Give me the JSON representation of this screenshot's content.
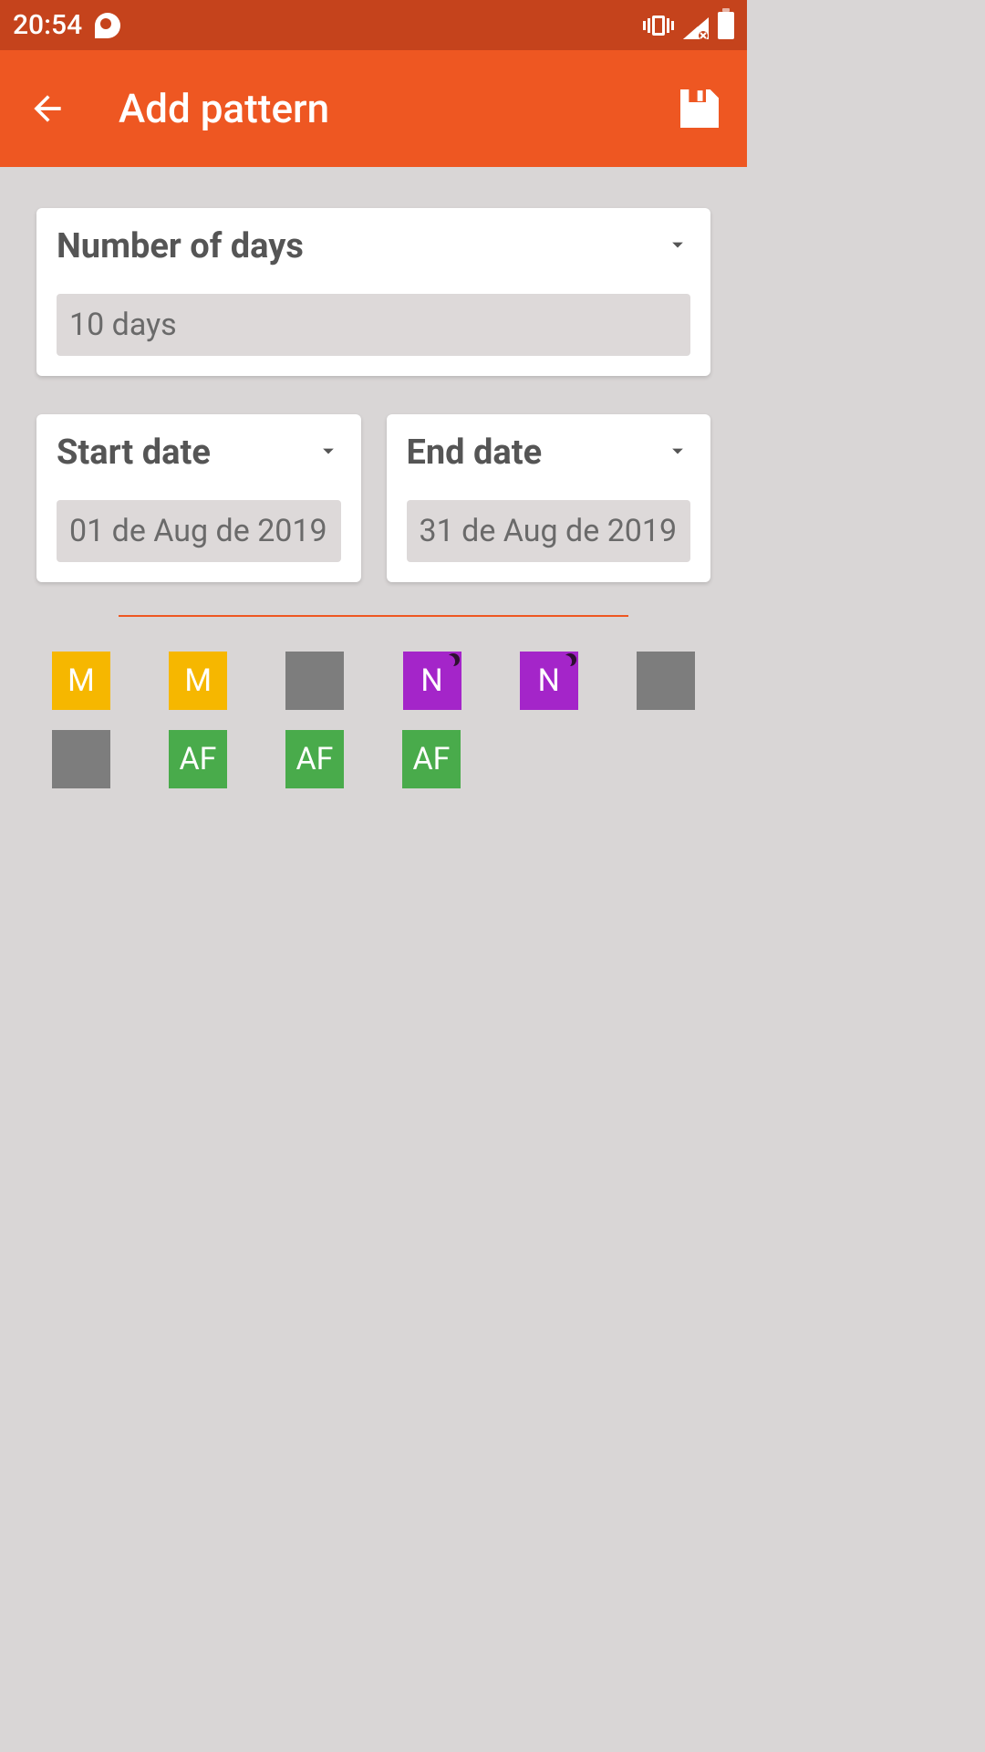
{
  "status_bar": {
    "time": "20:54"
  },
  "app_bar": {
    "title": "Add pattern"
  },
  "cards": {
    "days": {
      "label": "Number of days",
      "value": "10 days"
    },
    "start": {
      "label": "Start date",
      "value": "01 de Aug de 2019"
    },
    "end": {
      "label": "End date",
      "value": "31 de Aug de 2019"
    }
  },
  "pattern_colors": {
    "M": "#f6b700",
    "N": "#a425c9",
    "AF": "#49ab4b",
    "empty": "#7d7d7d"
  },
  "pattern_cells": [
    {
      "label": "M",
      "bg": "#f6b700",
      "moon": false
    },
    {
      "label": "M",
      "bg": "#f6b700",
      "moon": false
    },
    {
      "label": "",
      "bg": "#7d7d7d",
      "moon": false
    },
    {
      "label": "N",
      "bg": "#a425c9",
      "moon": true
    },
    {
      "label": "N",
      "bg": "#a425c9",
      "moon": true
    },
    {
      "label": "",
      "bg": "#7d7d7d",
      "moon": false
    },
    {
      "label": "",
      "bg": "#7d7d7d",
      "moon": false
    },
    {
      "label": "AF",
      "bg": "#49ab4b",
      "moon": false
    },
    {
      "label": "AF",
      "bg": "#49ab4b",
      "moon": false
    },
    {
      "label": "AF",
      "bg": "#49ab4b",
      "moon": false
    }
  ]
}
